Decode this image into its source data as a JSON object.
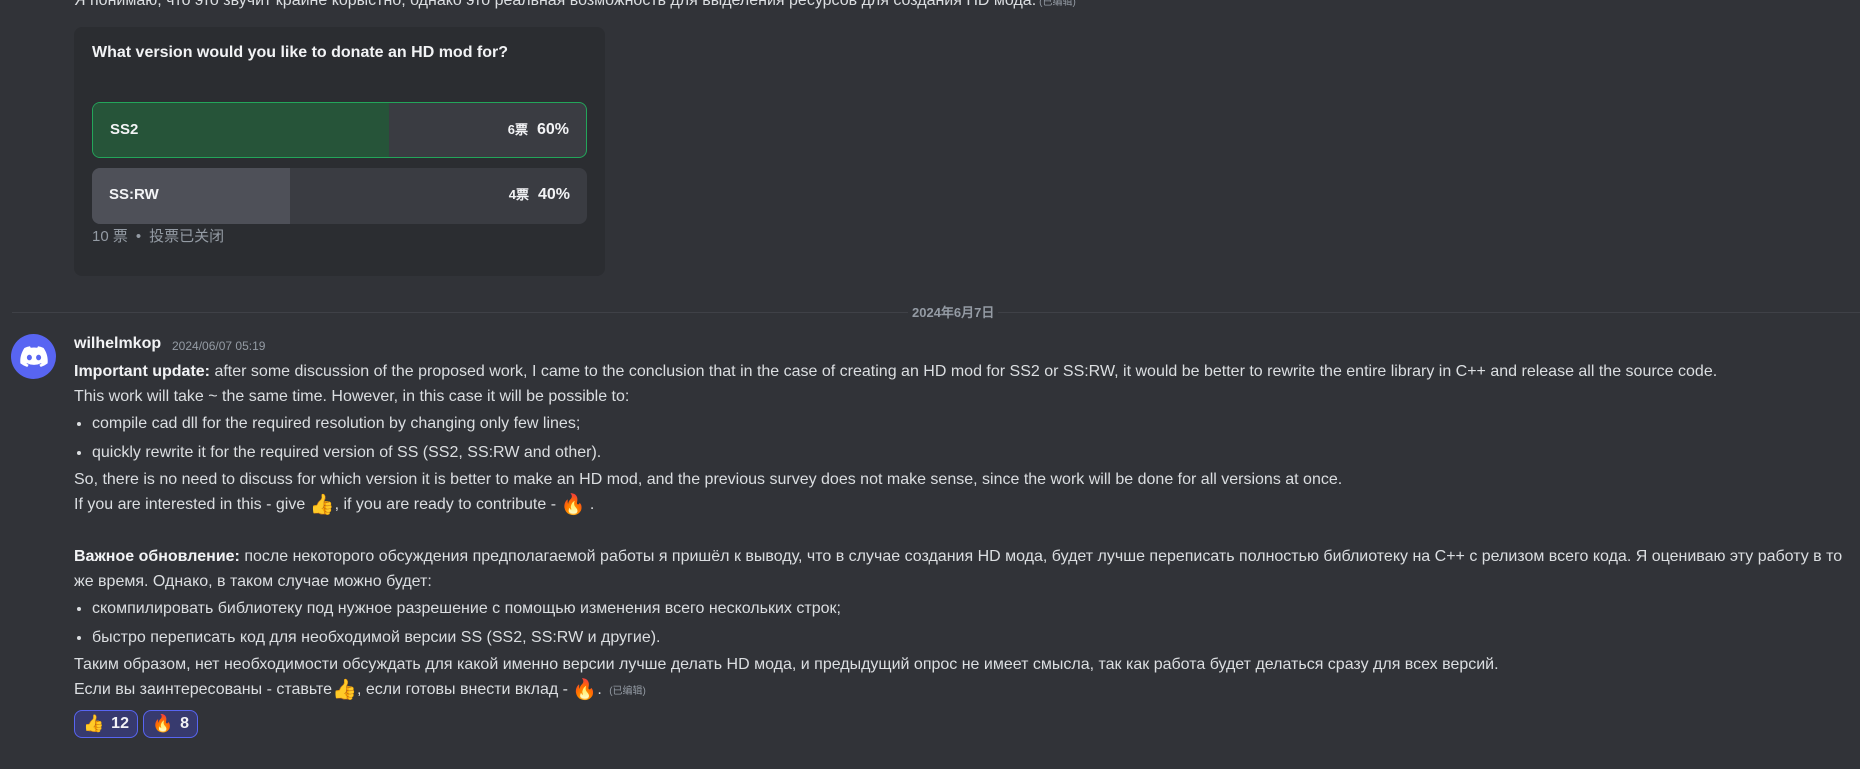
{
  "prev_message": {
    "text": "Я понимаю, что это звучит крайне корыстно, однако это реальная возможность для выделения ресурсов для создания HD мода.",
    "edited": "(已编辑)"
  },
  "poll": {
    "question": "What version would you like to donate an HD mod for?",
    "options": [
      {
        "label": "SS2",
        "votes": "6票",
        "percent": "60%",
        "fraction": 0.6,
        "selected": true
      },
      {
        "label": "SS:RW",
        "votes": "4票",
        "percent": "40%",
        "fraction": 0.4,
        "selected": false
      }
    ],
    "total_votes": "10 票",
    "status": "投票已关闭"
  },
  "date_divider": "2024年6月7日",
  "message": {
    "author": "wilhelmkop",
    "timestamp": "2024/06/07 05:19",
    "en": {
      "bold": "Important update:",
      "intro": "after some discussion of the proposed work, I came to the conclusion that in the case of creating an HD mod for SS2 or SS:RW, it would be better to rewrite the entire library in C++ and release all the source code.",
      "line2": "This work will take ~ the same time. However, in this case it will be possible to:",
      "bullets": [
        "compile cad dll for the required resolution by changing only few lines;",
        "quickly rewrite it for the required version of SS (SS2, SS:RW and other)."
      ],
      "line3": "So, there is no need to discuss for which version it is better to make an HD mod, and the previous survey does not make sense, since the work will be done for all versions at once.",
      "cta_a": "If you are interested in this - give",
      "cta_b": ", if you are ready to contribute -",
      "cta_c": "."
    },
    "ru": {
      "bold": "Важное обновление:",
      "intro": "после некоторого обсуждения предполагаемой работы я пришёл к выводу, что в случае создания HD мода, будет лучше переписать полностью библиотеку на C++ с релизом всего кода. Я оцениваю эту работу в то же время. Однако, в таком случае можно будет:",
      "bullets": [
        "скомпилировать библиотеку под нужное разрешение с помощью изменения всего нескольких строк;",
        "быстро переписать код для необходимой версии SS (SS2, SS:RW и другие)."
      ],
      "line3": "Таким образом, нет необходимости обсуждать для какой именно версии лучше делать HD мода, и предыдущий опрос не имеет смысла, так как работа будет делаться сразу для всех версий.",
      "cta_a": "Если вы заинтересованы - ставьте",
      "cta_b": ", если готовы внести вклад -",
      "cta_c": ".",
      "edited": "(已编辑)"
    },
    "emoji": {
      "thumbs_up": "👍",
      "fire": "🔥"
    },
    "reactions": [
      {
        "emoji": "👍",
        "count": "12"
      },
      {
        "emoji": "🔥",
        "count": "8"
      }
    ]
  },
  "colors": {
    "background": "#313338",
    "accent": "#5865f2",
    "poll_selected": "#23a55a"
  }
}
